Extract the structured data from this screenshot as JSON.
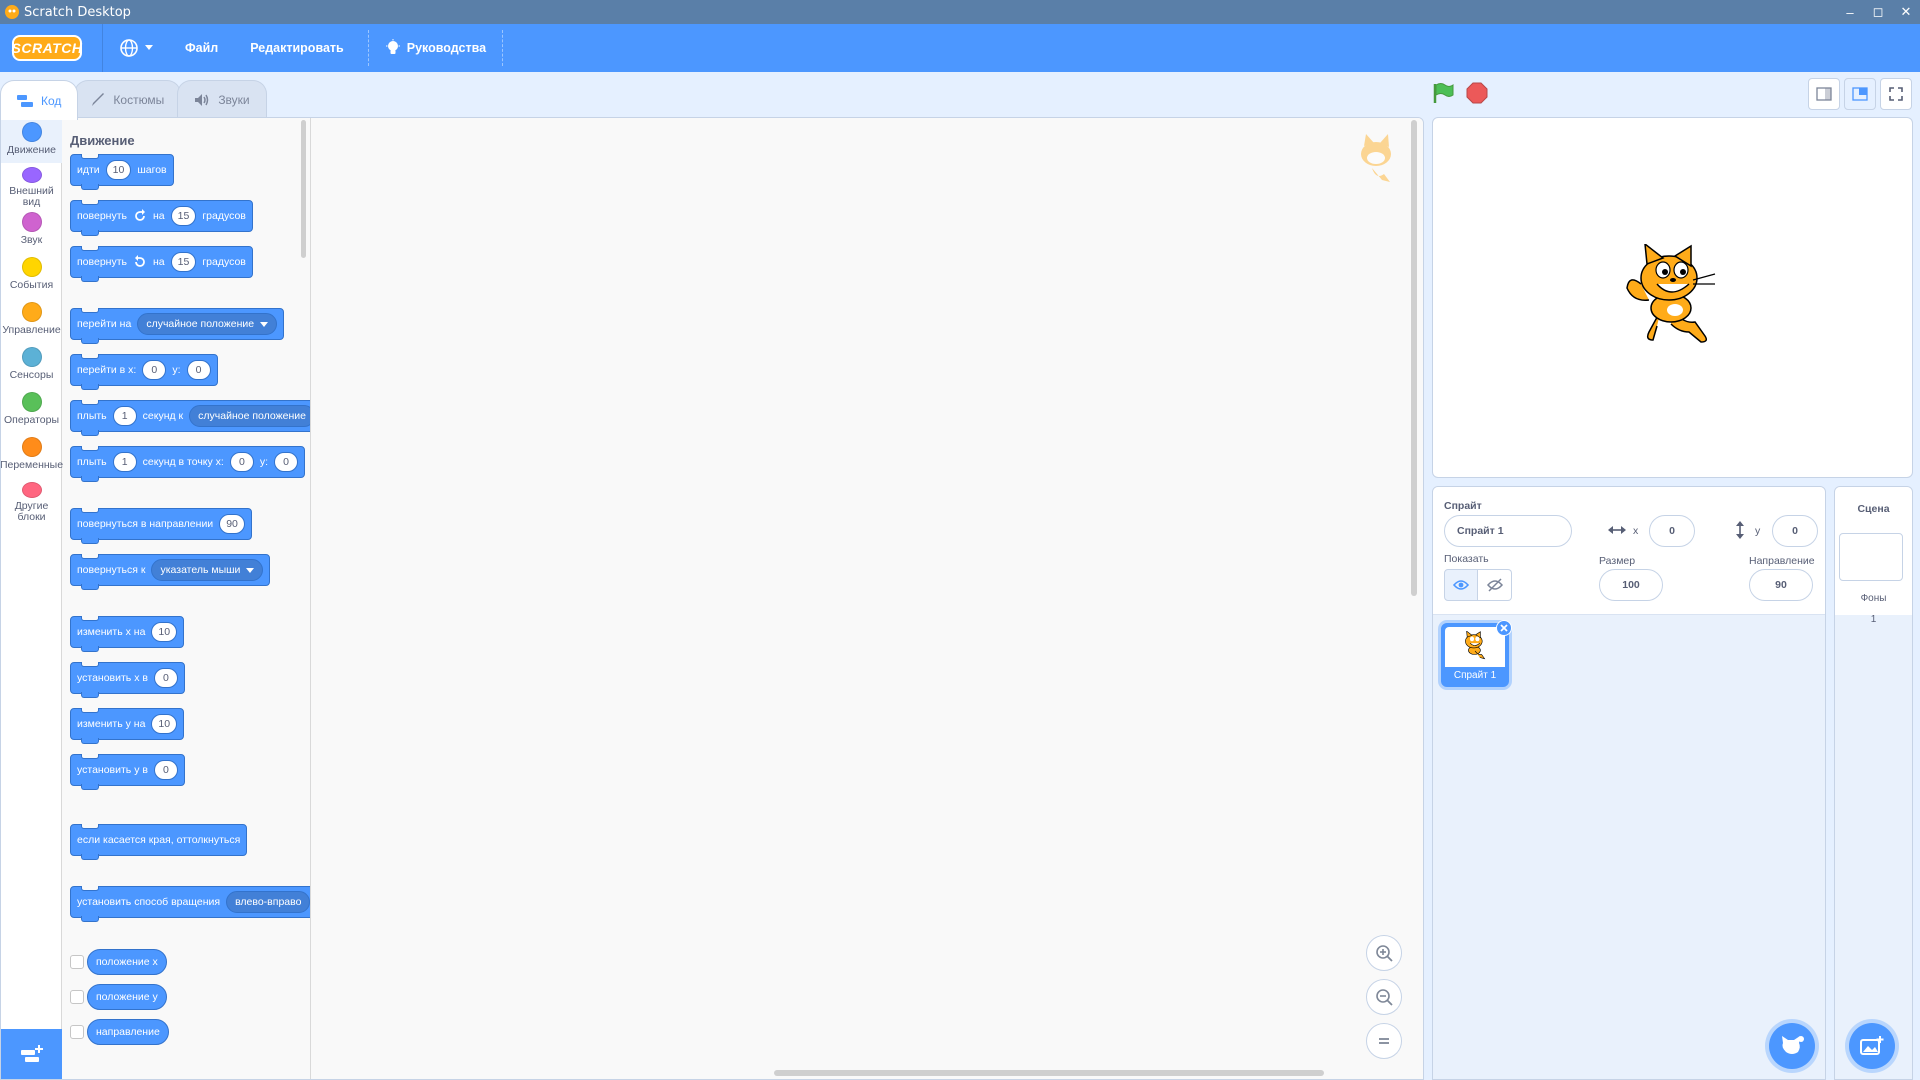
{
  "window": {
    "title": "Scratch Desktop",
    "minimize": "–",
    "restore": "◻",
    "close": "✕"
  },
  "menubar": {
    "logo": "SCRATCH",
    "file": "Файл",
    "edit": "Редактировать",
    "tutorials": "Руководства"
  },
  "tabs": [
    {
      "label": "Код"
    },
    {
      "label": "Костюмы"
    },
    {
      "label": "Звуки"
    }
  ],
  "categories": [
    {
      "label": "Движение",
      "color": "#4c97ff"
    },
    {
      "label": "Внешний вид",
      "color": "#9966ff"
    },
    {
      "label": "Звук",
      "color": "#cf63cf"
    },
    {
      "label": "События",
      "color": "#ffd500"
    },
    {
      "label": "Управление",
      "color": "#ffab19"
    },
    {
      "label": "Сенсоры",
      "color": "#5cb1d6"
    },
    {
      "label": "Операторы",
      "color": "#59c059"
    },
    {
      "label": "Переменные",
      "color": "#ff8c1a"
    },
    {
      "label": "Другие блоки",
      "color": "#ff6680"
    }
  ],
  "palette": {
    "title": "Движение",
    "move": {
      "a": "идти",
      "steps": "10",
      "b": "шагов"
    },
    "turn_right": {
      "a": "повернуть",
      "b": "на",
      "deg": "15",
      "c": "градусов"
    },
    "turn_left": {
      "a": "повернуть",
      "b": "на",
      "deg": "15",
      "c": "градусов"
    },
    "goto": {
      "a": "перейти на",
      "menu": "случайное положение"
    },
    "goto_xy": {
      "a": "перейти в x:",
      "x": "0",
      "b": "y:",
      "y": "0"
    },
    "glide": {
      "a": "плыть",
      "secs": "1",
      "b": "секунд к",
      "menu": "случайное положение"
    },
    "glide_xy": {
      "a": "плыть",
      "secs": "1",
      "b": "секунд в точку x:",
      "x": "0",
      "c": "y:",
      "y": "0"
    },
    "point_dir": {
      "a": "повернуться в направлении",
      "dir": "90"
    },
    "point_towards": {
      "a": "повернуться к",
      "menu": "указатель мыши"
    },
    "change_x": {
      "a": "изменить x на",
      "v": "10"
    },
    "set_x": {
      "a": "установить x в",
      "v": "0"
    },
    "change_y": {
      "a": "изменить y на",
      "v": "10"
    },
    "set_y": {
      "a": "установить y в",
      "v": "0"
    },
    "bounce": "если касается края, оттолкнуться",
    "rot_style": {
      "a": "установить способ вращения",
      "menu": "влево-вправо"
    },
    "reporters": [
      "положение x",
      "положение y",
      "направление"
    ]
  },
  "sprite_info": {
    "sprite_label": "Спрайт",
    "sprite_name": "Спрайт 1",
    "x_label": "x",
    "x_value": "0",
    "y_label": "y",
    "y_value": "0",
    "show_label": "Показать",
    "size_label": "Размер",
    "size_value": "100",
    "direction_label": "Направление",
    "direction_value": "90"
  },
  "sprites": [
    {
      "name": "Спрайт 1"
    }
  ],
  "stage_pane": {
    "title": "Сцена",
    "backdrops_label": "Фоны",
    "backdrops_count": "1"
  }
}
